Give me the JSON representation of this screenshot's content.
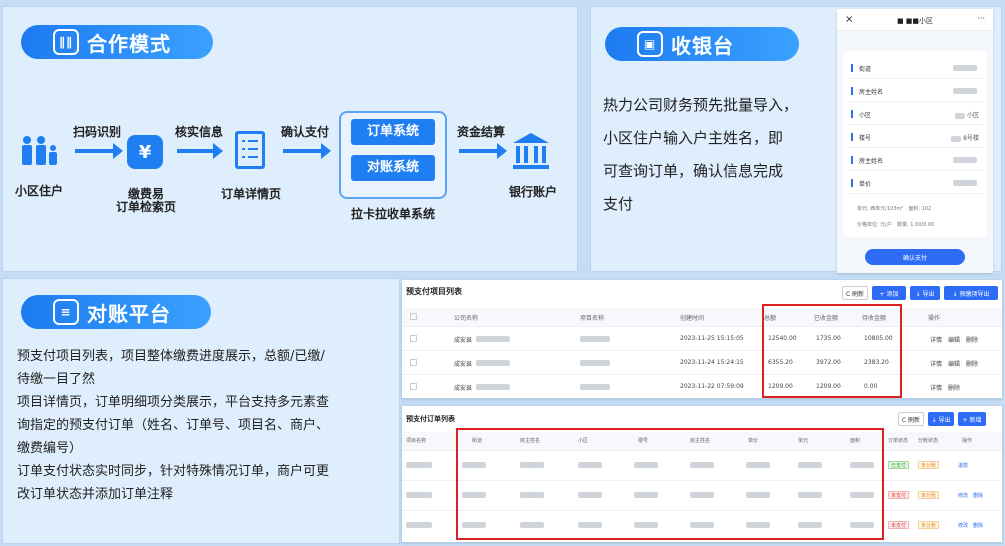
{
  "coop": {
    "title": "合作模式",
    "resident": "小区住户",
    "scan": "扫码识别",
    "app1": "缴费易",
    "app2": "订单检索页",
    "verify": "核实信息",
    "order_detail": "订单详情页",
    "pay": "确认支付",
    "sys_order": "订单系统",
    "sys_recon": "对账系统",
    "lakala": "拉卡拉收单系统",
    "settle": "资金结算",
    "bank": "银行账户"
  },
  "cashier": {
    "title": "收银台",
    "p1": "热力公司财务预先批量导入，",
    "p2": "小区住户输入户主姓名，即",
    "p3": "可查询订单，确认信息完成",
    "p4": "支付"
  },
  "phone": {
    "close": "×",
    "title": "■ ■■小区",
    "more": "···",
    "rows": [
      {
        "k": "街道",
        "v": ""
      },
      {
        "k": "房主姓名",
        "v": ""
      },
      {
        "k": "小区",
        "v": "小区"
      },
      {
        "k": "楼号",
        "v": "8号楼"
      },
      {
        "k": "房主姓名",
        "v": ""
      },
      {
        "k": "单价",
        "v": ""
      }
    ],
    "info1a": "单元: 西单元/103m²",
    "info1b": "面积: 102",
    "info2a": "价格单位: 元/户",
    "info2b": "数量: 1.00/0.00",
    "confirm": "确认支付"
  },
  "recon": {
    "title": "对账平台",
    "l1": "预支付项目列表，项目整体缴费进度展示，总额/已缴/",
    "l2": "待缴一目了然",
    "l3": "项目详情页，订单明细项分类展示，平台支持多元素查",
    "l4": "询指定的预支付订单（姓名、订单号、项目名、商户、",
    "l5": "缴费编号）",
    "l6": "订单支付状态实时同步，针对特殊情况订单，商户可更",
    "l7": "改订单状态并添加订单注释"
  },
  "t1": {
    "title": "预支付项目列表",
    "refresh": "C 刷新",
    "add": "+ 添加",
    "export": "↓ 导出",
    "export2": "↓ 预缴项导出",
    "headers": [
      "公司名称",
      "项目名称",
      "创建时间",
      "总额",
      "已收金额",
      "待收金额",
      "操作"
    ],
    "rows": [
      {
        "company": "成安县",
        "time": "2023-11-25 15:15:05",
        "total": "12540.00",
        "paid": "1735.00",
        "due": "10805.00",
        "ops": "详情　编辑　删除"
      },
      {
        "company": "成安县",
        "time": "2023-11-24 15:24:15",
        "total": "6355.20",
        "paid": "3972.00",
        "due": "2383.20",
        "ops": "详情　编辑　删除"
      },
      {
        "company": "成安县",
        "time": "2023-11-22 07:59:09",
        "total": "1209.00",
        "paid": "1209.00",
        "due": "0.00",
        "ops": "详情　删除"
      }
    ]
  },
  "t2": {
    "title": "预支付订单列表",
    "refresh": "C 刷新",
    "export": "↓ 导出",
    "add": "+ 新增",
    "headers": [
      "项目名称",
      "街道",
      "房主姓名",
      "小区",
      "楼号",
      "房主姓名",
      "单价",
      "单元",
      "面积",
      "订单状态",
      "分账状态",
      "操作"
    ],
    "rows": [
      {
        "s1": "已支付",
        "s2": "未分账",
        "ops": "退款"
      },
      {
        "s1": "未支付",
        "s2": "未分账",
        "ops": "修改　删除"
      },
      {
        "s1": "未支付",
        "s2": "未分账",
        "ops": "修改　删除"
      }
    ]
  },
  "colors": {
    "accent": "#1f7ff2",
    "highlight": "#e02020"
  }
}
